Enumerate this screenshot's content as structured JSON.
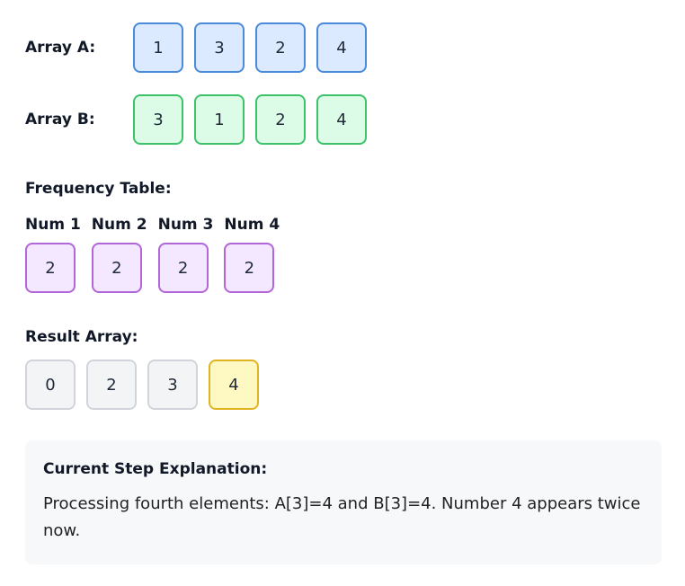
{
  "array_a": {
    "label": "Array A:",
    "values": [
      "1",
      "3",
      "2",
      "4"
    ]
  },
  "array_b": {
    "label": "Array B:",
    "values": [
      "3",
      "1",
      "2",
      "4"
    ]
  },
  "frequency": {
    "title": "Frequency Table:",
    "columns": [
      {
        "header": "Num 1",
        "value": "2"
      },
      {
        "header": "Num 2",
        "value": "2"
      },
      {
        "header": "Num 3",
        "value": "2"
      },
      {
        "header": "Num 4",
        "value": "2"
      }
    ]
  },
  "result": {
    "title": "Result Array:",
    "values": [
      "0",
      "2",
      "3",
      "4"
    ],
    "highlighted_index": 3
  },
  "explanation": {
    "title": "Current Step Explanation:",
    "text": "Processing fourth elements: A[3]=4 and B[3]=4. Number 4 appears twice now."
  },
  "colors": {
    "array_a": "#dbeafe",
    "array_b": "#dcfce7",
    "frequency": "#f3e8ff",
    "result": "#f3f4f6",
    "highlight": "#fef9c3"
  }
}
